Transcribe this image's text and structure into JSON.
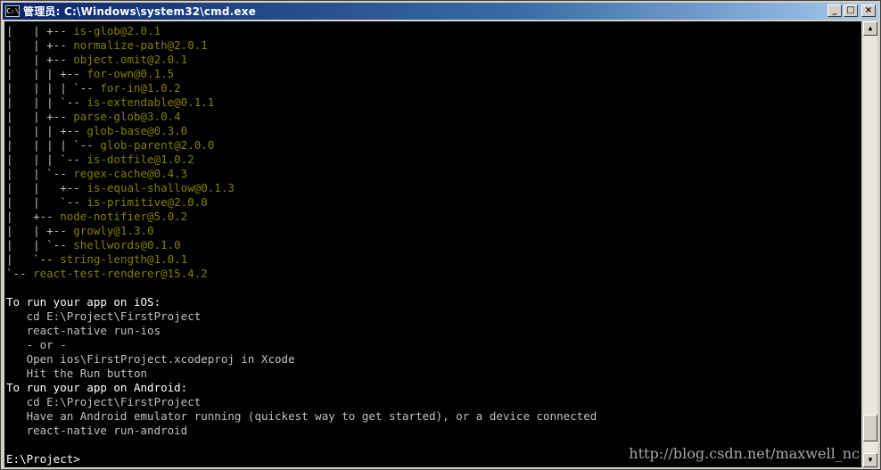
{
  "window": {
    "title": "管理员: C:\\Windows\\system32\\cmd.exe",
    "icon_name": "cmd-icon",
    "icon_glyph": "C:\\",
    "buttons": {
      "minimize": "_",
      "maximize": "□",
      "close": "×"
    }
  },
  "console": {
    "colors": {
      "background": "#000000",
      "text": "#c0c0c0",
      "highlight": "#ffffff",
      "package": "#808000"
    },
    "tree_lines": [
      {
        "prefix": "|   | +-- ",
        "pkg": "is-glob@2.0.1"
      },
      {
        "prefix": "|   | +-- ",
        "pkg": "normalize-path@2.0.1"
      },
      {
        "prefix": "|   | +-- ",
        "pkg": "object.omit@2.0.1"
      },
      {
        "prefix": "|   | | +-- ",
        "pkg": "for-own@0.1.5"
      },
      {
        "prefix": "|   | | | `-- ",
        "pkg": "for-in@1.0.2"
      },
      {
        "prefix": "|   | | `-- ",
        "pkg": "is-extendable@0.1.1"
      },
      {
        "prefix": "|   | +-- ",
        "pkg": "parse-glob@3.0.4"
      },
      {
        "prefix": "|   | | +-- ",
        "pkg": "glob-base@0.3.0"
      },
      {
        "prefix": "|   | | | `-- ",
        "pkg": "glob-parent@2.0.0"
      },
      {
        "prefix": "|   | | `-- ",
        "pkg": "is-dotfile@1.0.2"
      },
      {
        "prefix": "|   | `-- ",
        "pkg": "regex-cache@0.4.3"
      },
      {
        "prefix": "|   |   +-- ",
        "pkg": "is-equal-shallow@0.1.3"
      },
      {
        "prefix": "|   |   `-- ",
        "pkg": "is-primitive@2.0.0"
      },
      {
        "prefix": "|   +-- ",
        "pkg": "node-notifier@5.0.2"
      },
      {
        "prefix": "|   | +-- ",
        "pkg": "growly@1.3.0"
      },
      {
        "prefix": "|   | `-- ",
        "pkg": "shellwords@0.1.0"
      },
      {
        "prefix": "|   `-- ",
        "pkg": "string-length@1.0.1"
      },
      {
        "prefix": "`-- ",
        "pkg": "react-test-renderer@15.4.2"
      }
    ],
    "instruction_lines": [
      {
        "text": "",
        "white": false
      },
      {
        "text": "To run your app on iOS:",
        "white": true
      },
      {
        "text": "   cd E:\\Project\\FirstProject",
        "white": false
      },
      {
        "text": "   react-native run-ios",
        "white": false
      },
      {
        "text": "   - or -",
        "white": false
      },
      {
        "text": "   Open ios\\FirstProject.xcodeproj in Xcode",
        "white": false
      },
      {
        "text": "   Hit the Run button",
        "white": false
      },
      {
        "text": "To run your app on Android:",
        "white": true
      },
      {
        "text": "   cd E:\\Project\\FirstProject",
        "white": false
      },
      {
        "text": "   Have an Android emulator running (quickest way to get started), or a device connected",
        "white": false
      },
      {
        "text": "   react-native run-android",
        "white": false
      },
      {
        "text": "",
        "white": false
      },
      {
        "text": "E:\\Project>",
        "white": true
      }
    ],
    "watermark": "http://blog.csdn.net/maxwell_nc"
  },
  "scrollbar": {
    "up_arrow": "▲",
    "down_arrow": "▼",
    "position_fraction": 0.97
  }
}
